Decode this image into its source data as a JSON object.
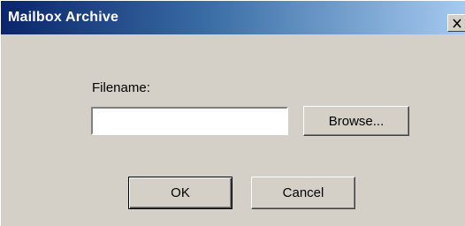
{
  "window": {
    "title": "Mailbox Archive",
    "title_bar_color": "#0a246a",
    "background_color": "#d4d0c8"
  },
  "title_bar": {
    "close_icon": "close-icon"
  },
  "form": {
    "filename_label": "Filename:",
    "filename_value": "",
    "browse_label": "Browse..."
  },
  "actions": {
    "ok_label": "OK",
    "cancel_label": "Cancel"
  }
}
